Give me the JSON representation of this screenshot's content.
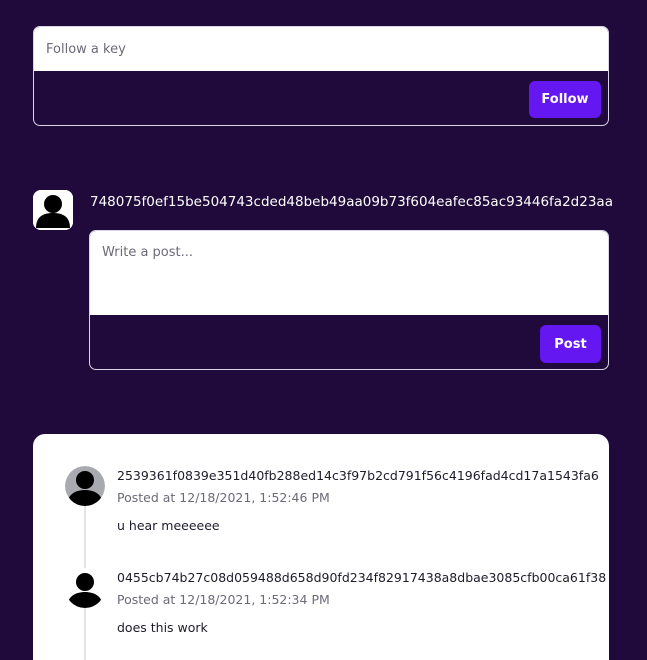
{
  "follow": {
    "placeholder": "Follow a key",
    "button_label": "Follow"
  },
  "profile": {
    "pubkey": "748075f0ef15be504743cded48beb49aa09b73f604eafec85ac93446fa2d23aa",
    "avatar_icon": "user-silhouette-icon"
  },
  "composer": {
    "placeholder": "Write a post...",
    "button_label": "Post"
  },
  "feed": {
    "posts": [
      {
        "author": "2539361f0839e351d40fb288ed14c3f97b2cd791f56c4196fad4cd17a1543fa6",
        "timestamp": "Posted at 12/18/2021, 1:52:46 PM",
        "content": "u hear meeeeee"
      },
      {
        "author": "0455cb74b27c08d059488d658d90fd234f82917438a8dbae3085cfb00ca61f38",
        "timestamp": "Posted at 12/18/2021, 1:52:34 PM",
        "content": "does this work"
      }
    ]
  },
  "colors": {
    "background": "#1f0a3b",
    "accent": "#6417f0",
    "card": "#ffffff"
  }
}
